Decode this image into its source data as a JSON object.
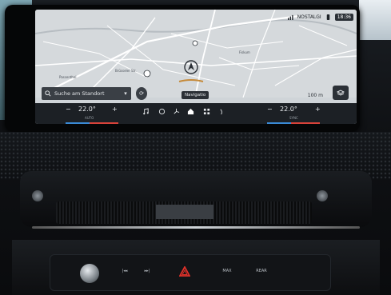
{
  "status_bar": {
    "network": "NOSTALGI",
    "time": "18:36"
  },
  "map": {
    "search_placeholder": "Suche am Standort",
    "mode_label": "Navigatio",
    "scale": "100 m",
    "place_labels": [
      "Passenthal",
      "Fiskum",
      "Brüsseler Str."
    ]
  },
  "climate": {
    "left_temp": "22.0°",
    "left_sub": "AUTO",
    "right_temp": "22.0°",
    "right_sub": "SYNC",
    "minus": "−",
    "plus": "+"
  },
  "controls": {
    "max_label": "MAX",
    "rear_label": "REAR",
    "prev_label": "|◂◂",
    "next_label": "▸▸|"
  },
  "colors": {
    "heat_red": "#d8423a",
    "cool_blue": "#3a8ad6",
    "hazard_red": "#e0312a"
  },
  "icons": [
    "search-icon",
    "map-layer-icon",
    "home-icon",
    "music-icon",
    "fan-icon",
    "seat-heat-icon",
    "hazard-icon",
    "chevron-down-icon"
  ]
}
